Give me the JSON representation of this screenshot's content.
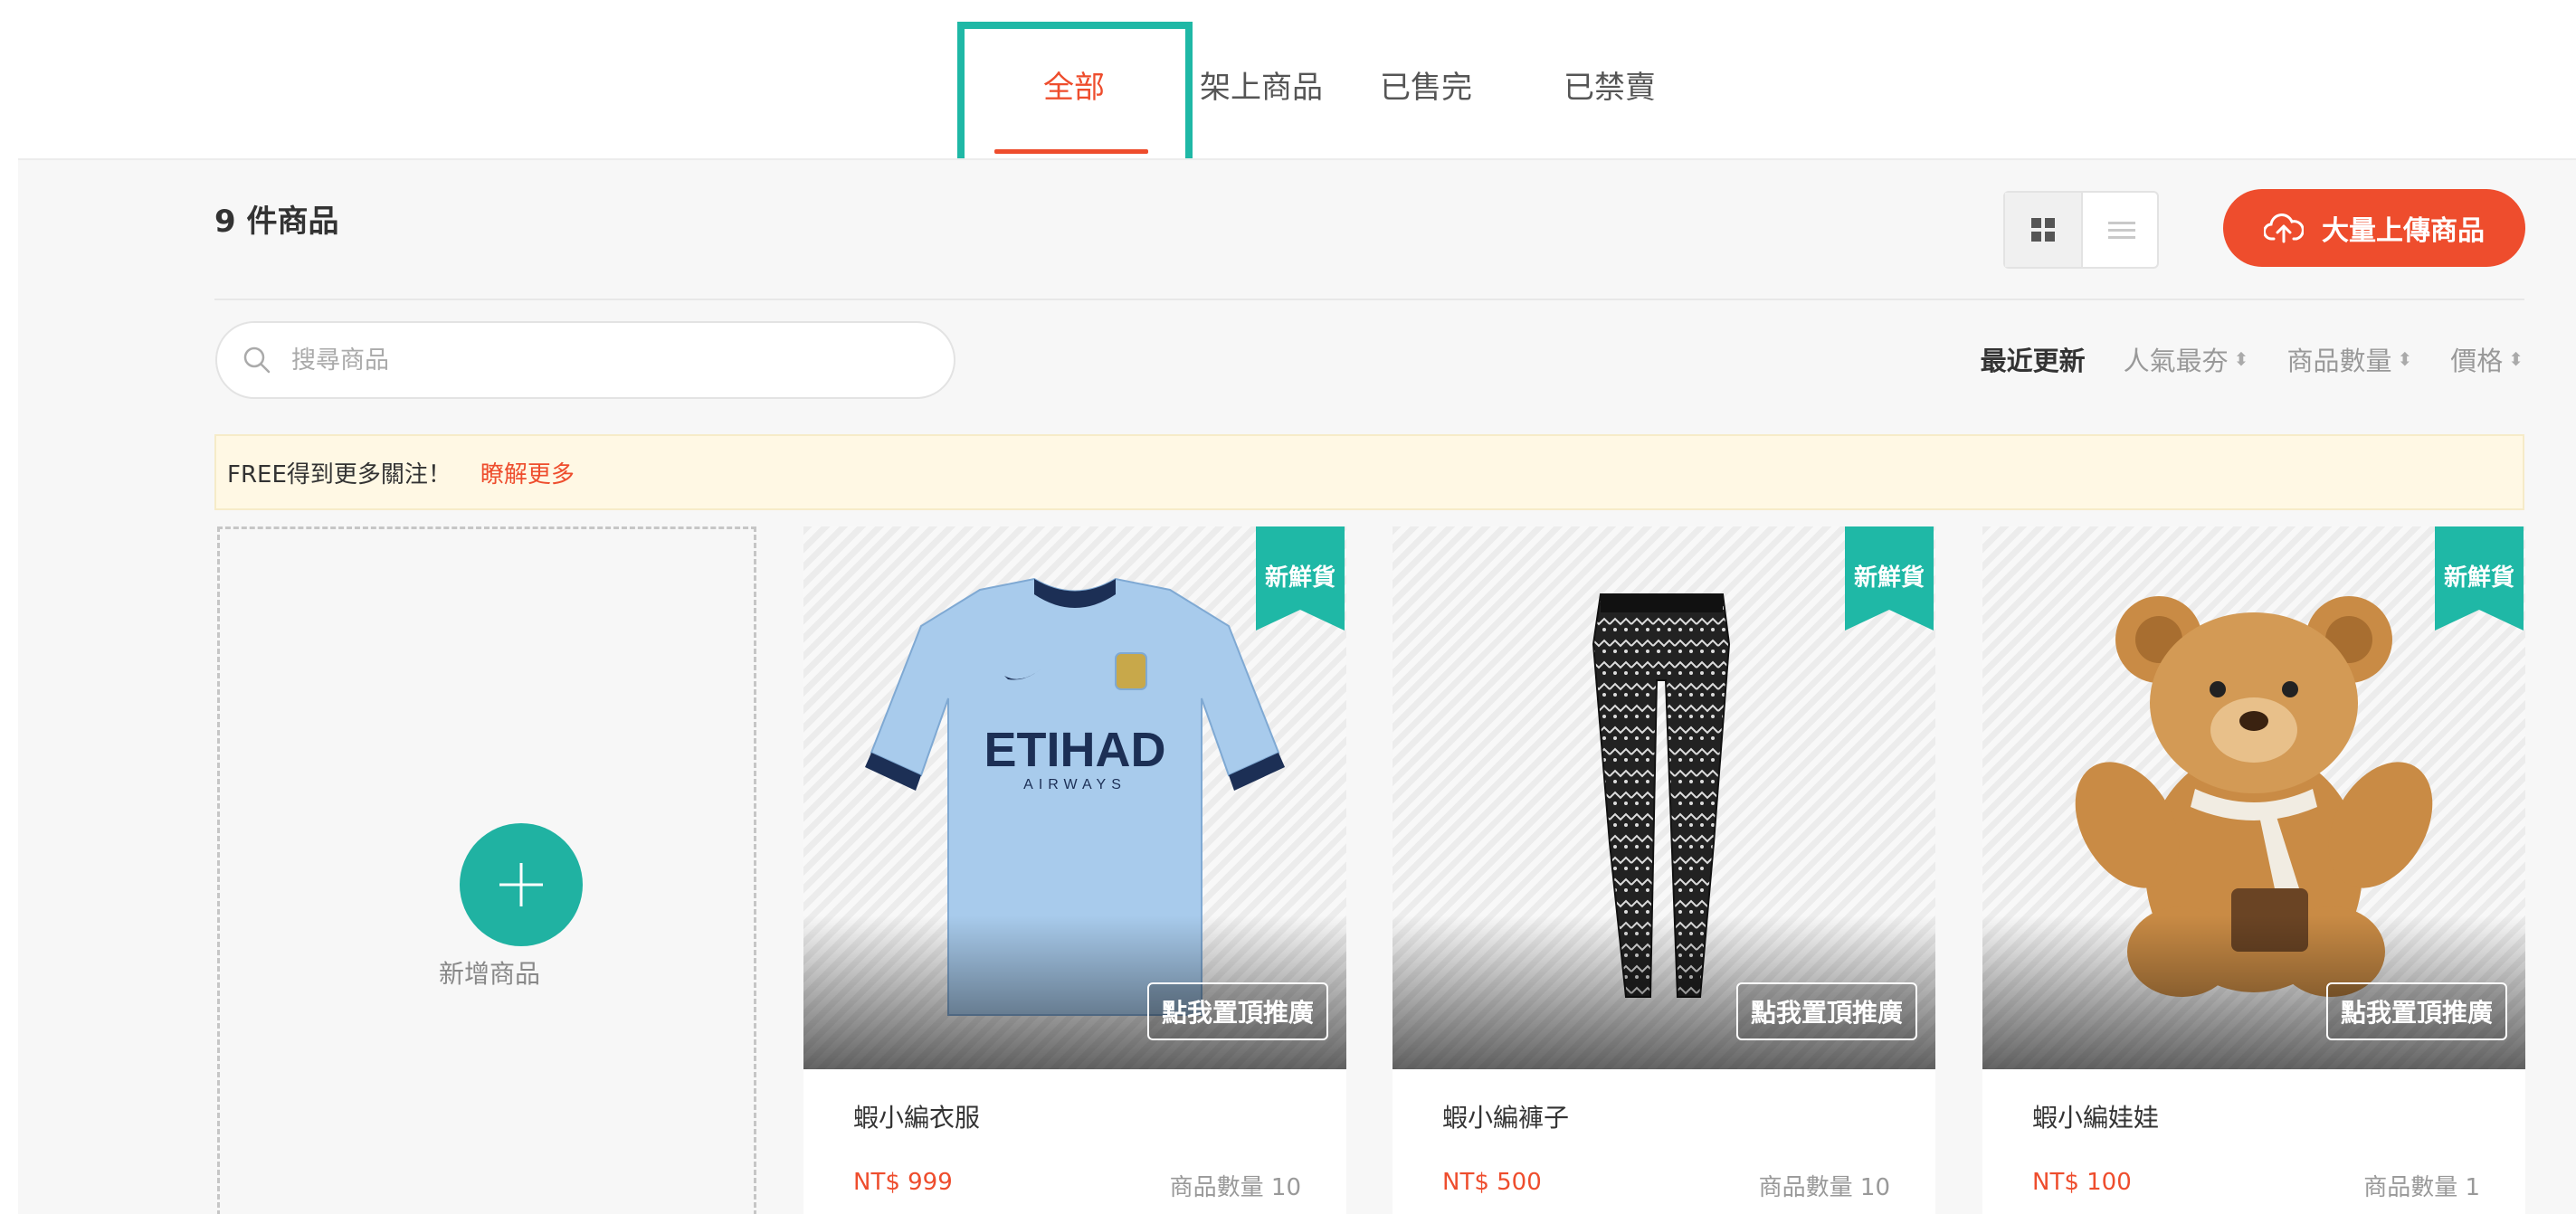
{
  "tabs": [
    {
      "label": "全部",
      "active": true
    },
    {
      "label": "架上商品",
      "active": false
    },
    {
      "label": "已售完",
      "active": false
    },
    {
      "label": "已禁賣",
      "active": false
    }
  ],
  "header": {
    "count_title": "9 件商品",
    "upload_label": "大量上傳商品"
  },
  "view_toggle": {
    "selected": "grid"
  },
  "search": {
    "placeholder": "搜尋商品",
    "value": ""
  },
  "sort": [
    {
      "label": "最近更新",
      "active": true,
      "arrows": ""
    },
    {
      "label": "人氣最夯",
      "active": false,
      "arrows": "⬍"
    },
    {
      "label": "商品數量",
      "active": false,
      "arrows": "⬍"
    },
    {
      "label": "價格",
      "active": false,
      "arrows": "⬍"
    }
  ],
  "promo": {
    "text": "FREE得到更多關注！",
    "link": "瞭解更多"
  },
  "add_product": {
    "label": "新增商品"
  },
  "products": [
    {
      "name": "蝦小編衣服",
      "price": "NT$ 999",
      "qty": "商品數量 10",
      "badge": "新鮮貨",
      "boost": "點我置頂推廣",
      "image": "jersey"
    },
    {
      "name": "蝦小編褲子",
      "price": "NT$ 500",
      "qty": "商品數量 10",
      "badge": "新鮮貨",
      "boost": "點我置頂推廣",
      "image": "leggings"
    },
    {
      "name": "蝦小編娃娃",
      "price": "NT$ 100",
      "qty": "商品數量 1",
      "badge": "新鮮貨",
      "boost": "點我置頂推廣",
      "image": "teddy-bear"
    }
  ],
  "colors": {
    "accent": "#ee4d2d",
    "teal": "#1fb8a6",
    "promo_bg": "#fff8e4"
  }
}
